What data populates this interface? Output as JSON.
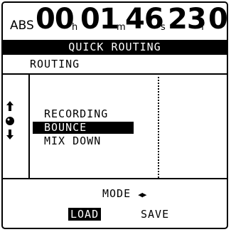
{
  "timecode": {
    "label": "ABS",
    "hours": "00",
    "hours_unit": "h",
    "minutes": "01",
    "minutes_unit": "m",
    "seconds": "46",
    "seconds_unit": "s",
    "frames": "23",
    "frames_unit": "f",
    "subframe": "0"
  },
  "screen_title": "QUICK ROUTING",
  "section_title": "ROUTING",
  "menu": {
    "items": [
      {
        "label": "RECORDING",
        "selected": false
      },
      {
        "label": "BOUNCE",
        "selected": true
      },
      {
        "label": "MIX DOWN",
        "selected": false
      }
    ]
  },
  "icons": {
    "up": "up-arrow-icon",
    "dial": "jog-dial-icon",
    "down": "down-arrow-icon"
  },
  "mode": {
    "label": "MODE",
    "arrows": "◀▶"
  },
  "buttons": {
    "load": "LOAD",
    "save": "SAVE"
  }
}
